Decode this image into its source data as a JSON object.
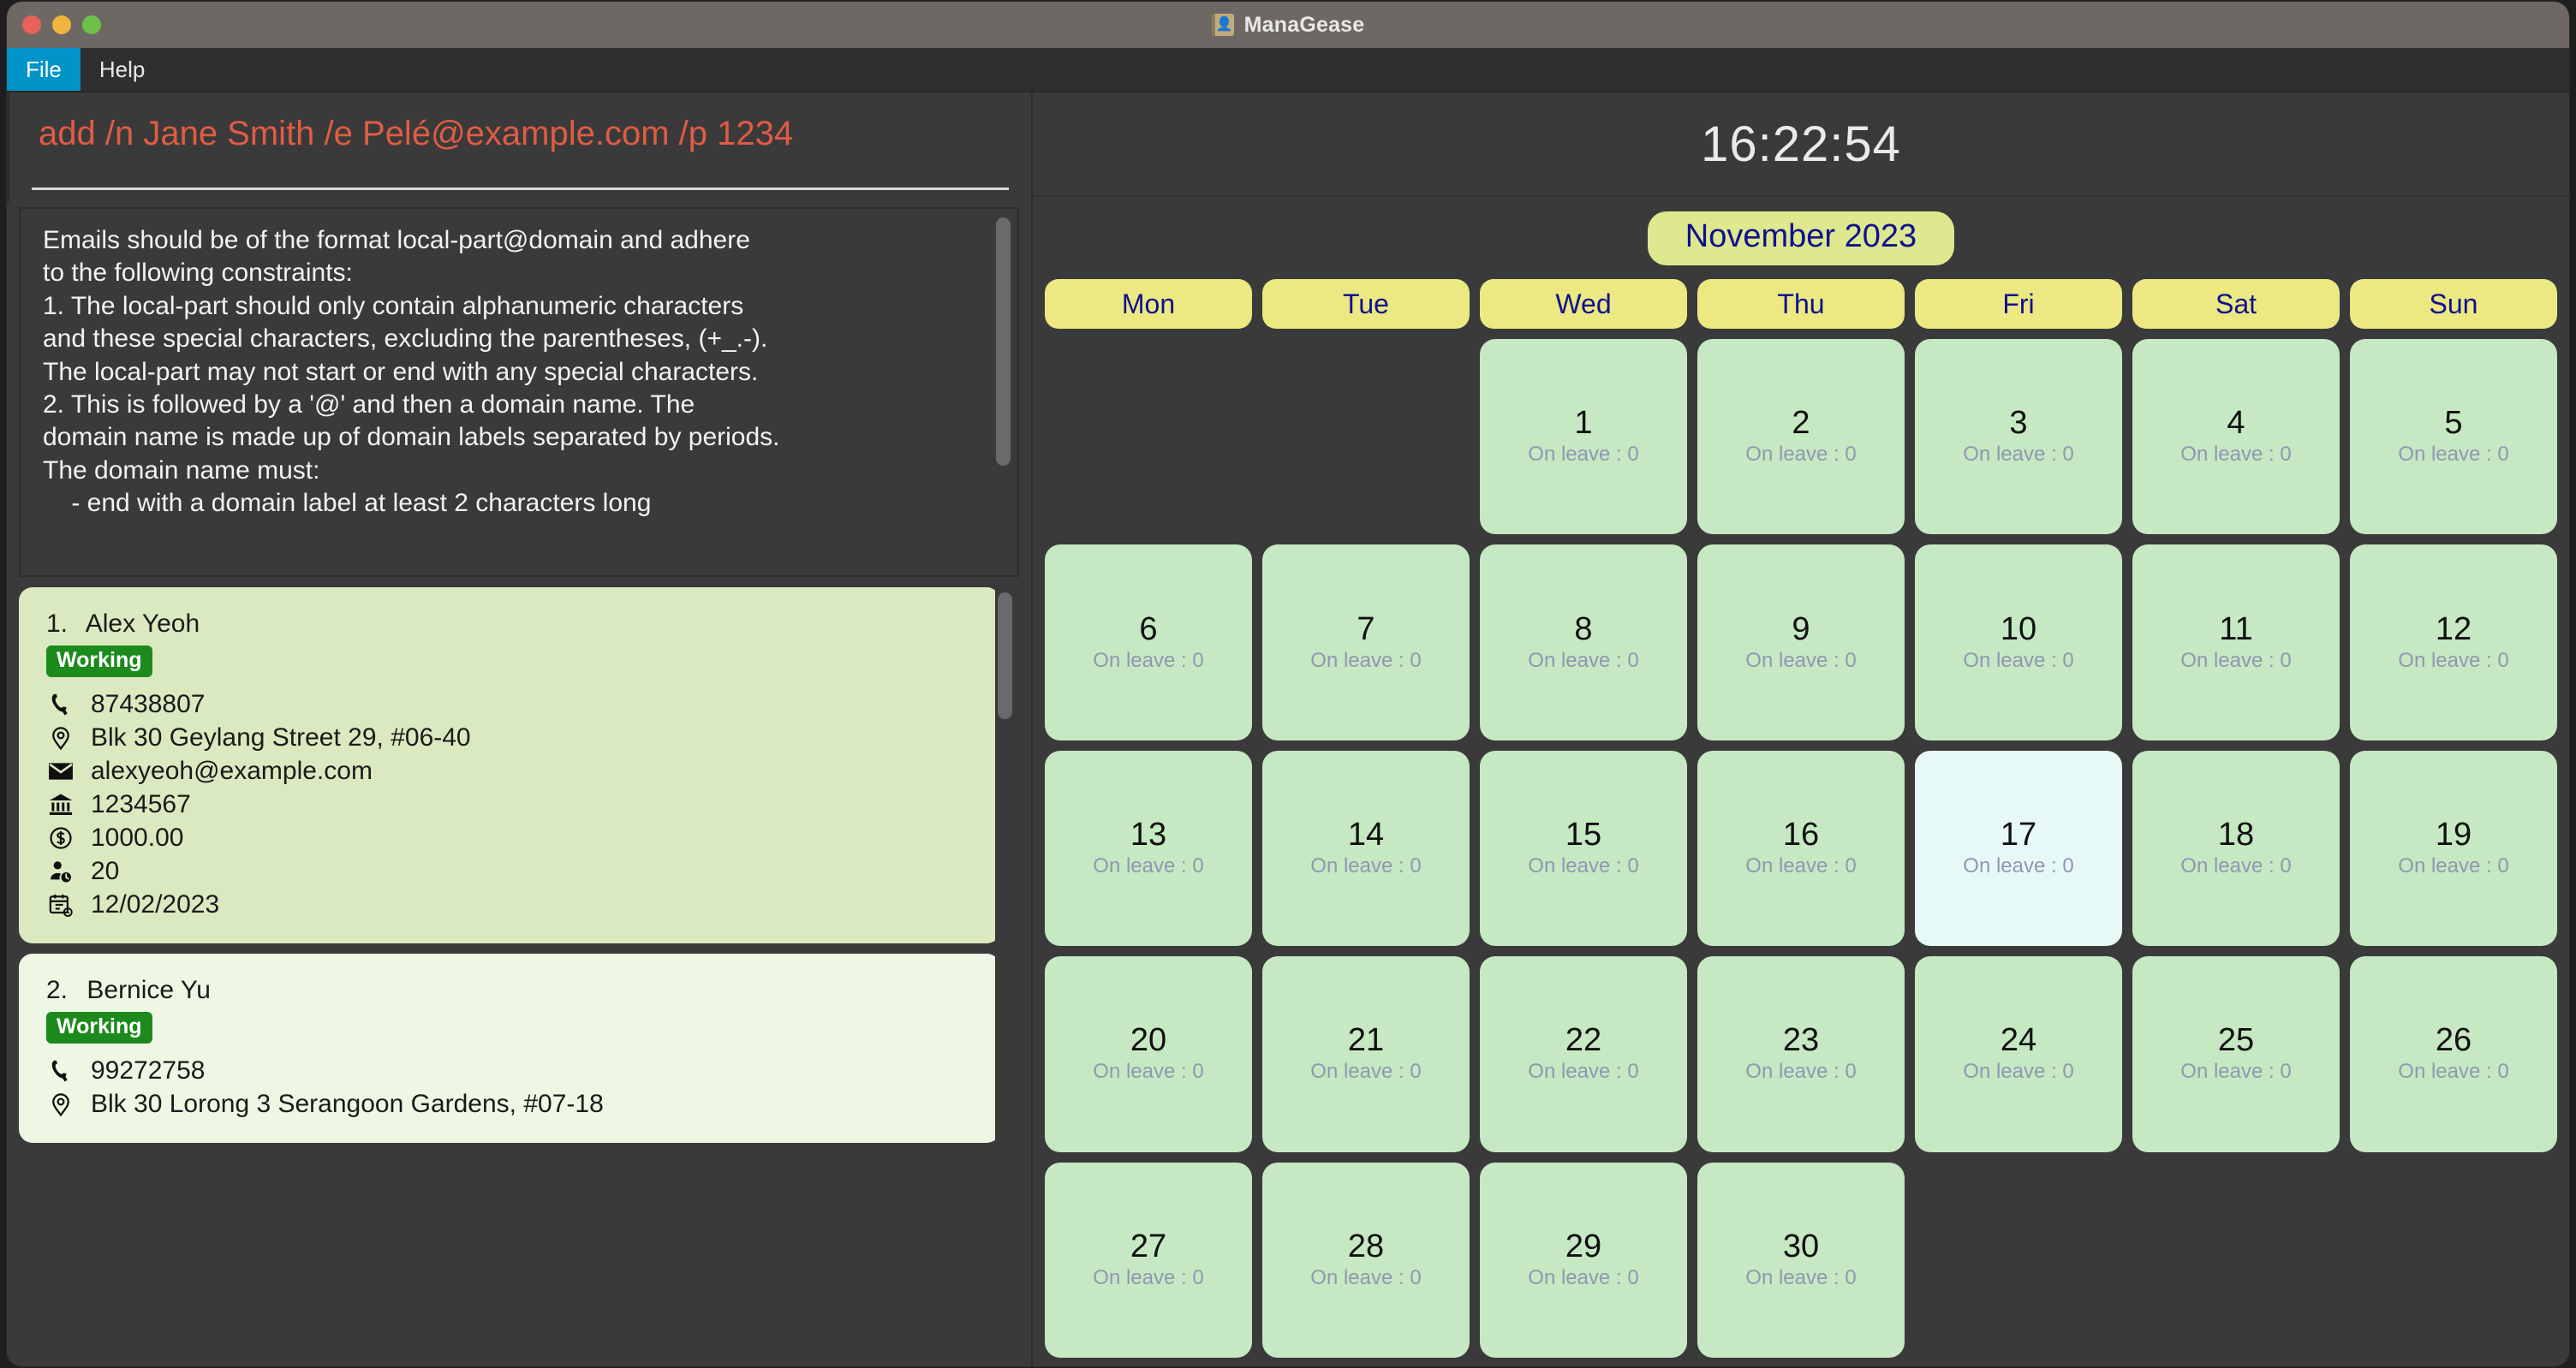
{
  "window": {
    "title": "ManaGease",
    "icon": "address-book-icon",
    "traffic_lights": [
      "close",
      "minimize",
      "maximize"
    ]
  },
  "menu": {
    "items": [
      {
        "label": "File",
        "active": true
      },
      {
        "label": "Help",
        "active": false
      }
    ]
  },
  "command": {
    "text": "add /n Jane Smith /e Pelé@example.com /p 1234",
    "color": "#e05c45"
  },
  "result": {
    "text": "Emails should be of the format local-part@domain and adhere\nto the following constraints:\n1. The local-part should only contain alphanumeric characters\nand these special characters, excluding the parentheses, (+_.-).\nThe local-part may not start or end with any special characters.\n2. This is followed by a '@' and then a domain name. The\ndomain name is made up of domain labels separated by periods.\nThe domain name must:\n    - end with a domain label at least 2 characters long"
  },
  "person_list": {
    "cards": [
      {
        "index": "1.",
        "name": "Alex Yeoh",
        "status": "Working",
        "shade": "shade-a",
        "fields": [
          {
            "icon": "phone-icon",
            "value": "87438807"
          },
          {
            "icon": "location-pin-icon",
            "value": "Blk 30 Geylang Street 29, #06-40"
          },
          {
            "icon": "envelope-icon",
            "value": "alexyeoh@example.com"
          },
          {
            "icon": "bank-icon",
            "value": "1234567"
          },
          {
            "icon": "dollar-circle-icon",
            "value": "1000.00"
          },
          {
            "icon": "person-clock-icon",
            "value": "20"
          },
          {
            "icon": "calendar-clock-icon",
            "value": "12/02/2023"
          }
        ]
      },
      {
        "index": "2.",
        "name": "Bernice Yu",
        "status": "Working",
        "shade": "shade-b",
        "fields": [
          {
            "icon": "phone-icon",
            "value": "99272758"
          },
          {
            "icon": "location-pin-icon",
            "value": "Blk 30 Lorong 3 Serangoon Gardens, #07-18"
          }
        ]
      }
    ]
  },
  "clock": {
    "time": "16:22:54"
  },
  "calendar": {
    "month_label": "November 2023",
    "weekdays": [
      "Mon",
      "Tue",
      "Wed",
      "Thu",
      "Fri",
      "Sat",
      "Sun"
    ],
    "leading_blanks": 2,
    "today": 17,
    "on_leave_prefix": "On leave : ",
    "days": [
      {
        "day": 1,
        "on_leave": 0
      },
      {
        "day": 2,
        "on_leave": 0
      },
      {
        "day": 3,
        "on_leave": 0
      },
      {
        "day": 4,
        "on_leave": 0
      },
      {
        "day": 5,
        "on_leave": 0
      },
      {
        "day": 6,
        "on_leave": 0
      },
      {
        "day": 7,
        "on_leave": 0
      },
      {
        "day": 8,
        "on_leave": 0
      },
      {
        "day": 9,
        "on_leave": 0
      },
      {
        "day": 10,
        "on_leave": 0
      },
      {
        "day": 11,
        "on_leave": 0
      },
      {
        "day": 12,
        "on_leave": 0
      },
      {
        "day": 13,
        "on_leave": 0
      },
      {
        "day": 14,
        "on_leave": 0
      },
      {
        "day": 15,
        "on_leave": 0
      },
      {
        "day": 16,
        "on_leave": 0
      },
      {
        "day": 17,
        "on_leave": 0
      },
      {
        "day": 18,
        "on_leave": 0
      },
      {
        "day": 19,
        "on_leave": 0
      },
      {
        "day": 20,
        "on_leave": 0
      },
      {
        "day": 21,
        "on_leave": 0
      },
      {
        "day": 22,
        "on_leave": 0
      },
      {
        "day": 23,
        "on_leave": 0
      },
      {
        "day": 24,
        "on_leave": 0
      },
      {
        "day": 25,
        "on_leave": 0
      },
      {
        "day": 26,
        "on_leave": 0
      },
      {
        "day": 27,
        "on_leave": 0
      },
      {
        "day": 28,
        "on_leave": 0
      },
      {
        "day": 29,
        "on_leave": 0
      },
      {
        "day": 30,
        "on_leave": 0
      }
    ]
  },
  "colors": {
    "accent_menu": "#0294c8",
    "command_text": "#e05c45",
    "day_cell": "#c6e8c3",
    "today_cell": "#e7f9f7",
    "weekday_cell": "#ece882",
    "month_pill": "#dde88f",
    "navy_text": "#10108e",
    "status_green": "#1c8a1c"
  }
}
